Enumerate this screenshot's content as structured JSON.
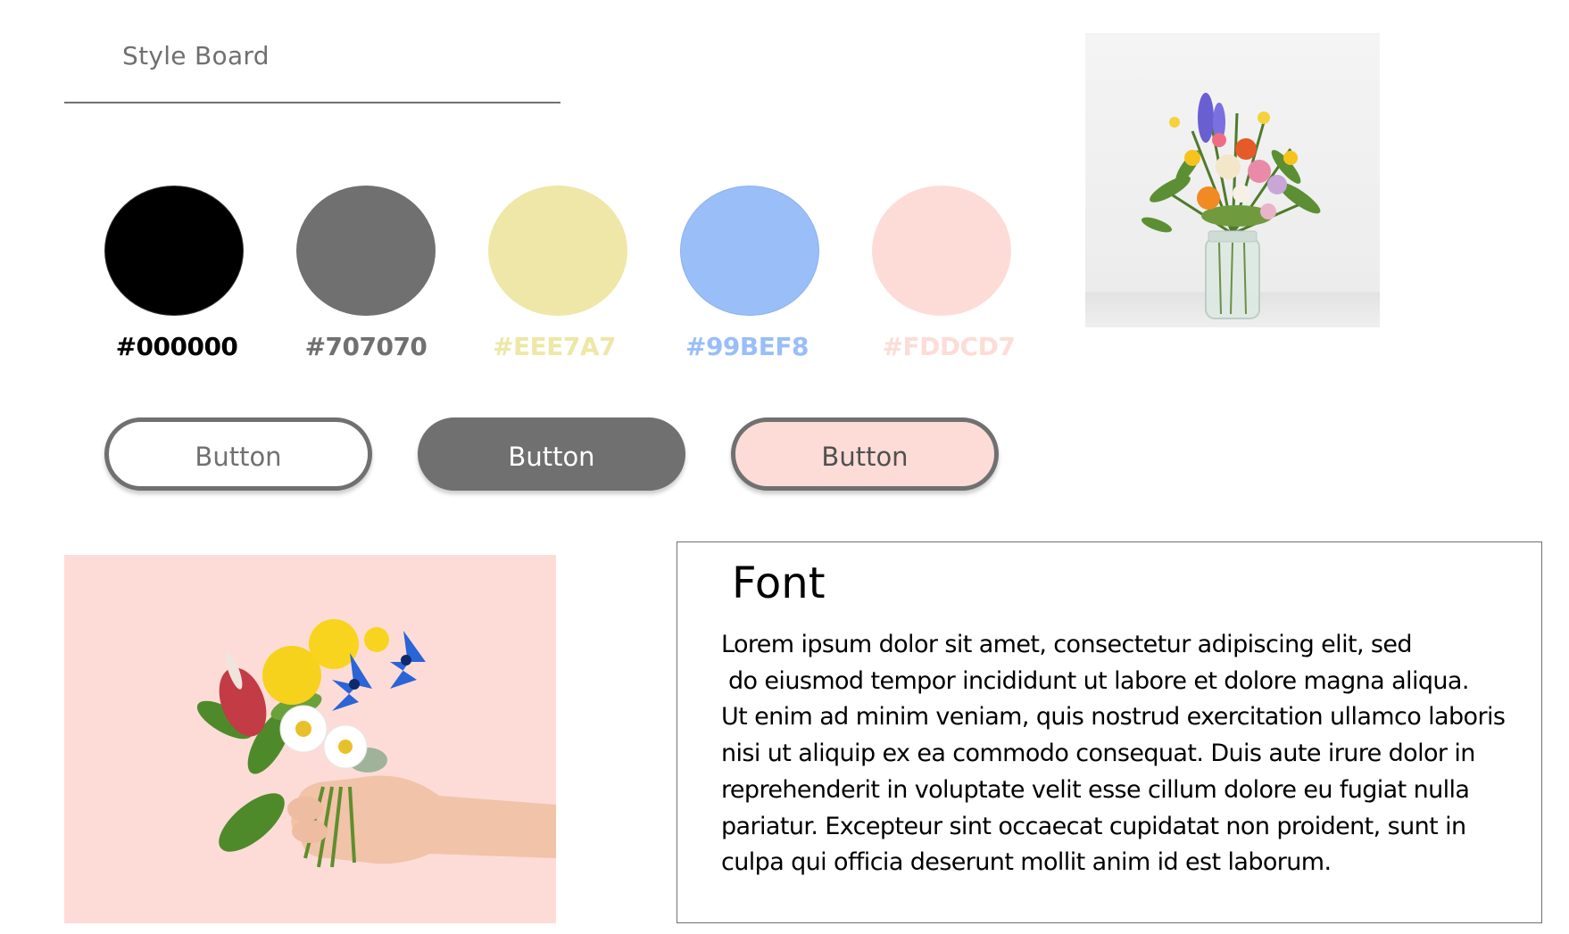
{
  "board": {
    "title": "Style Board"
  },
  "palette": [
    {
      "hex": "#000000",
      "label": "#000000"
    },
    {
      "hex": "#707070",
      "label": "#707070"
    },
    {
      "hex": "#EEE7A7",
      "label": "#EEE7A7"
    },
    {
      "hex": "#99BEF8",
      "label": "#99BEF8"
    },
    {
      "hex": "#FDDCD7",
      "label": "#FDDCD7"
    }
  ],
  "buttons": [
    {
      "label": "Button",
      "fill": "#FFFFFF",
      "text_color": "#707070"
    },
    {
      "label": "Button",
      "fill": "#707070",
      "text_color": "#FFFFFF"
    },
    {
      "label": "Button",
      "fill": "#FDDCD7",
      "text_color": "#505050"
    }
  ],
  "images": [
    {
      "name": "flower-vase-photo"
    },
    {
      "name": "hand-holding-flowers-photo",
      "background": "#FDDCD7"
    }
  ],
  "font_sample": {
    "heading": "Font",
    "lines": [
      "Lorem ipsum dolor sit amet, consectetur adipiscing elit, sed",
      " do eiusmod tempor incididunt ut labore et dolore magna aliqua.",
      "Ut enim ad minim veniam, quis nostrud exercitation ullamco laboris",
      "nisi ut aliquip ex ea commodo consequat. Duis aute irure dolor in",
      "reprehenderit in voluptate velit esse cillum dolore eu fugiat nulla",
      "pariatur. Excepteur sint occaecat cupidatat non proident, sunt in",
      "culpa qui officia deserunt mollit anim id est laborum."
    ]
  }
}
